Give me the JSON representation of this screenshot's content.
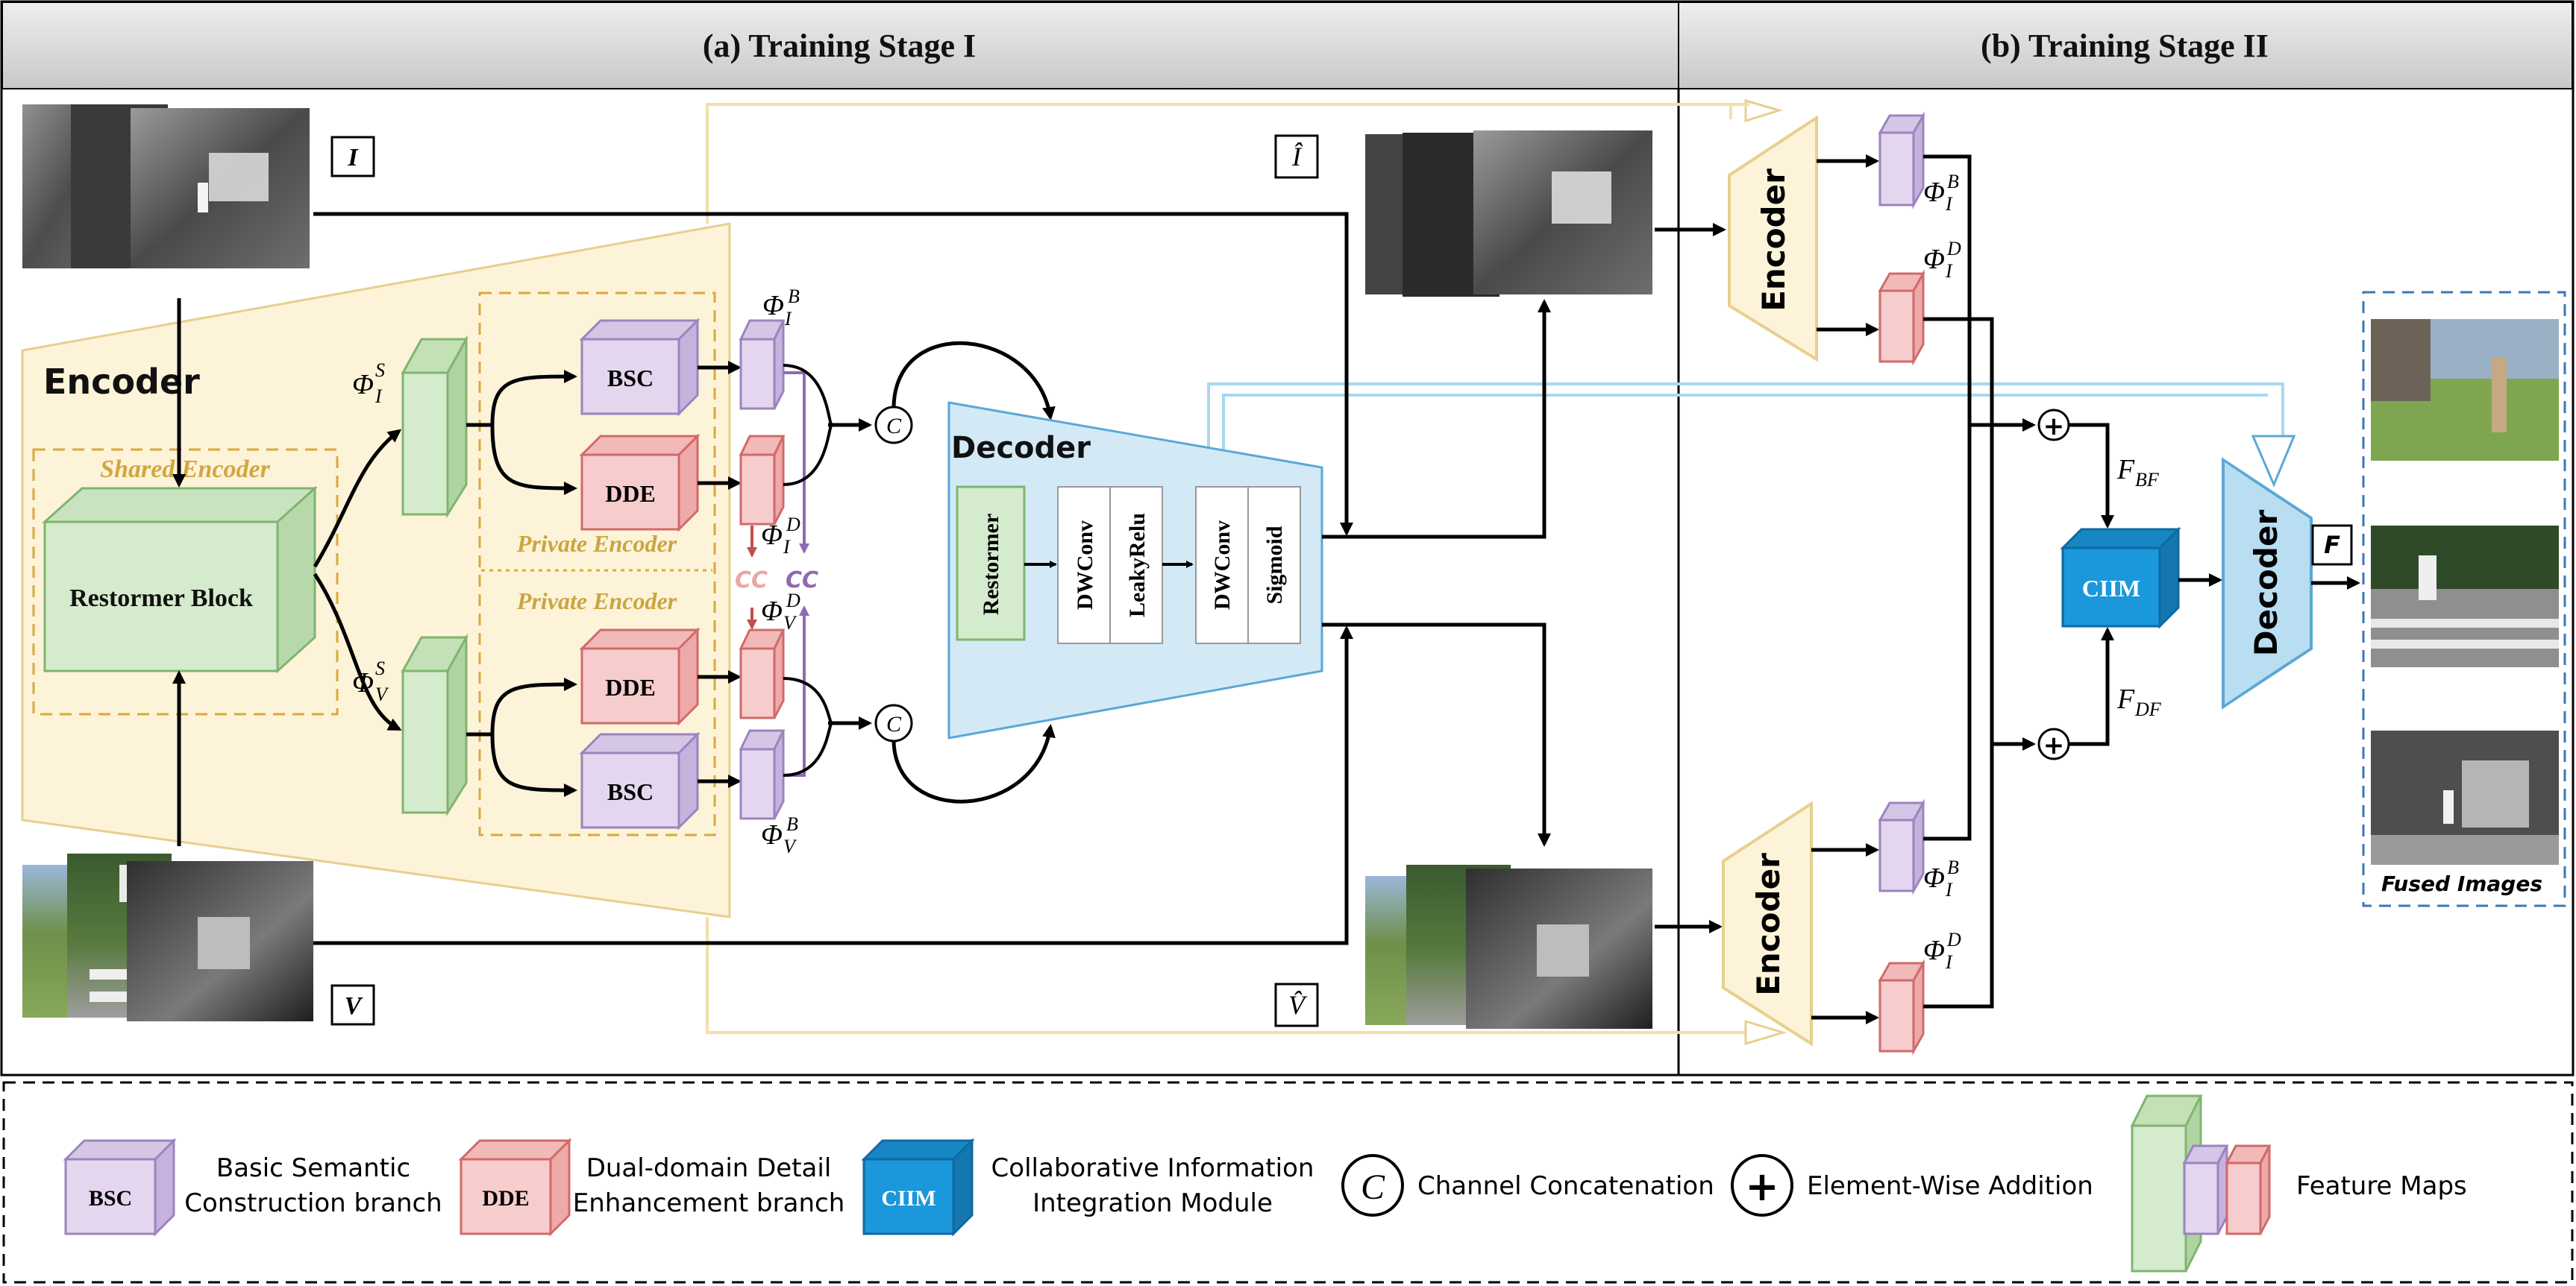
{
  "stages": {
    "stage1_title": "(a) Training Stage I",
    "stage2_title": "(b) Training Stage II"
  },
  "inputs": {
    "infrared_label": "I",
    "visible_label": "V",
    "recon_infrared_label": "Î",
    "recon_visible_label": "V̂"
  },
  "encoder": {
    "title": "Encoder",
    "shared_title": "Shared Encoder",
    "shared_block": "Restormer Block",
    "private_title_top": "Private Encoder",
    "private_title_bottom": "Private Encoder",
    "bsc": "BSC",
    "dde": "DDE",
    "phi_base": "Φ",
    "sup_s": "S",
    "sup_b": "B",
    "sup_d": "D",
    "sub_i": "I",
    "sub_v": "V",
    "cc": "CC"
  },
  "decoder": {
    "title": "Decoder",
    "restormer": "Restormer",
    "dwconv1": "DWConv",
    "leakyrelu": "LeakyRelu",
    "dwconv2": "DWConv",
    "sigmoid": "Sigmoid"
  },
  "concat_symbol": "C",
  "add_symbol": "+",
  "stage2": {
    "encoder_top": "Encoder",
    "encoder_bottom": "Encoder",
    "decoder": "Decoder",
    "ciim": "CIIM",
    "fbf_main": "F",
    "fbf_sub": "BF",
    "fdf_main": "F",
    "fdf_sub": "DF",
    "output_label": "F",
    "fused_caption": "Fused Images"
  },
  "legend": {
    "bsc_box": "BSC",
    "bsc_text_1": "Basic Semantic",
    "bsc_text_2": "Construction branch",
    "dde_box": "DDE",
    "dde_text_1": "Dual-domain Detail",
    "dde_text_2": "Enhancement branch",
    "ciim_box": "CIIM",
    "ciim_text_1": "Collaborative Information",
    "ciim_text_2": "Integration Module",
    "concat_symbol": "C",
    "concat_text": "Channel Concatenation",
    "add_symbol": "+",
    "add_text": "Element-Wise Addition",
    "feature_text": "Feature Maps"
  },
  "colors": {
    "encoder_fill": "#fdf3d9",
    "encoder_stroke": "#e8cf8f",
    "shared_fill": "#d5ebcd",
    "shared_stroke": "#7fb56e",
    "bsc_fill": "#e3d6ee",
    "bsc_stroke": "#9d83bf",
    "dde_fill": "#f7cccc",
    "dde_stroke": "#d06a6a",
    "decoder_fill": "#d3eaf6",
    "decoder_stroke": "#5aa8d6",
    "ciim_fill": "#1b97db",
    "private_label": "#c9a640",
    "header_fill": "#d6d6d6"
  }
}
